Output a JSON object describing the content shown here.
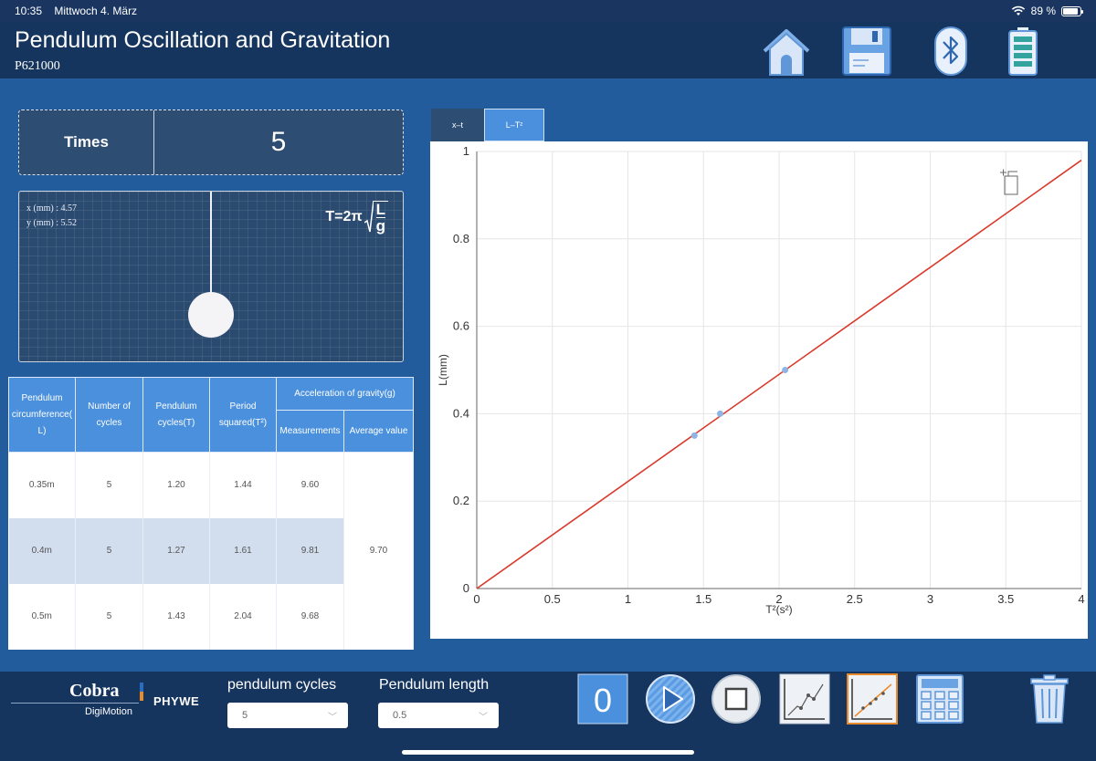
{
  "status": {
    "time": "10:35",
    "date": "Mittwoch 4. März",
    "battery": "89 %"
  },
  "header": {
    "title": "Pendulum Oscillation and Gravitation",
    "subtitle": "P621000",
    "icons": [
      "home-icon",
      "save-icon",
      "bluetooth-icon",
      "battery-icon"
    ]
  },
  "times": {
    "label": "Times",
    "value": "5"
  },
  "pendulum": {
    "x_readout": "x (mm) : 4.57",
    "y_readout": "y (mm) : 5.52",
    "formula_prefix": "T=2π",
    "formula_num": "L",
    "formula_den": "g"
  },
  "table": {
    "headers": {
      "length": "Pendulum circumference( L)",
      "cycles": "Number of cycles",
      "period": "Pendulum cycles(T)",
      "period_sq": "Period squared(T²)",
      "gravity": "Acceleration of gravity(g)",
      "measurements": "Measurements",
      "average": "Average value"
    },
    "rows": [
      {
        "length": "0.35m",
        "cycles": "5",
        "period": "1.20",
        "period_sq": "1.44",
        "measurement": "9.60"
      },
      {
        "length": "0.4m",
        "cycles": "5",
        "period": "1.27",
        "period_sq": "1.61",
        "measurement": "9.81"
      },
      {
        "length": "0.5m",
        "cycles": "5",
        "period": "1.43",
        "period_sq": "2.04",
        "measurement": "9.68"
      }
    ],
    "average": "9.70"
  },
  "tabs": [
    {
      "label": "x–t"
    },
    {
      "label": "L–T²"
    }
  ],
  "chart_data": {
    "type": "scatter",
    "xlabel": "T²(s²)",
    "ylabel": "L(mm)",
    "xlim": [
      0,
      4
    ],
    "ylim": [
      0,
      1
    ],
    "xticks": [
      "0",
      "0.5",
      "1",
      "1.5",
      "2",
      "2.5",
      "3",
      "3.5",
      "4"
    ],
    "yticks": [
      "0",
      "0.2",
      "0.4",
      "0.6",
      "0.8",
      "1"
    ],
    "grid": true,
    "points": [
      {
        "x": 1.44,
        "y": 0.35
      },
      {
        "x": 1.61,
        "y": 0.4
      },
      {
        "x": 2.04,
        "y": 0.5
      }
    ],
    "fit_line": {
      "x": [
        0,
        4
      ],
      "y": [
        0,
        0.98
      ]
    },
    "colors": {
      "points": "#8fb4e6",
      "fit": "#d93a2b"
    }
  },
  "footer": {
    "brand": {
      "name": "Cobra",
      "sub": "DigiMotion",
      "maker": "PHYWE"
    },
    "cycles": {
      "label": "pendulum cycles",
      "value": "5"
    },
    "length": {
      "label": "Pendulum length",
      "value": "0.5"
    },
    "counter": "0",
    "tools": [
      "play-icon",
      "stop-icon",
      "graph-xt-icon",
      "graph-lt-icon",
      "calculator-icon",
      "trash-icon"
    ]
  },
  "colors": {
    "background": "#235c9c",
    "header": "#16355e",
    "accent": "#4a90dc",
    "orange": "#e88a2a"
  }
}
